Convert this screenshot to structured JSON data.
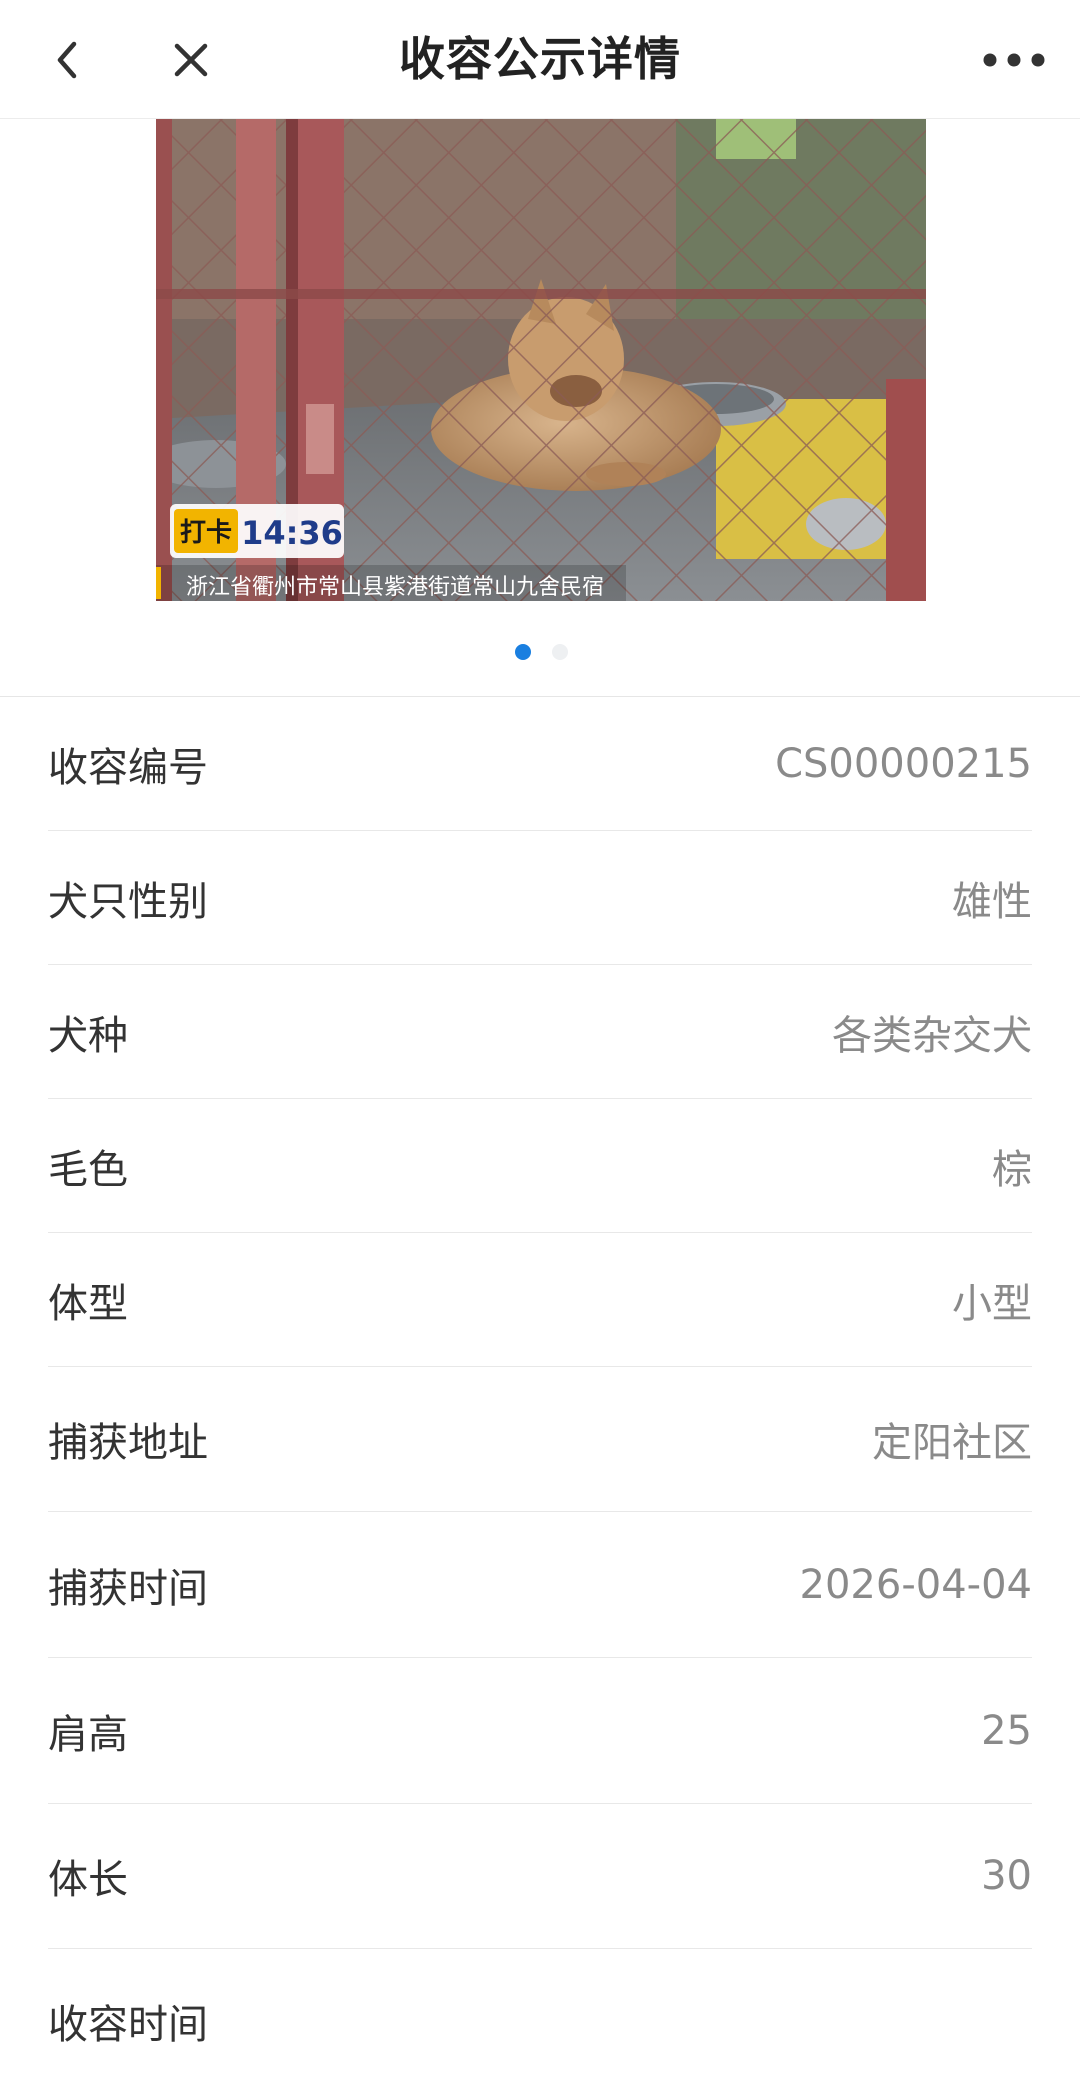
{
  "header": {
    "title": "收容公示详情",
    "back_icon": "chevron-left-icon",
    "close_icon": "close-icon",
    "more_icon": "more-horizontal-icon"
  },
  "carousel": {
    "photo": {
      "badge_label": "打卡",
      "badge_time": "14:36",
      "location_caption": "浙江省衢州市常山县紫港街道常山九舍民宿"
    },
    "slide_count": 2,
    "active_slide": 1,
    "accent_color": "#1a7fe0"
  },
  "details": [
    {
      "label": "收容编号",
      "value": "CS00000215"
    },
    {
      "label": "犬只性别",
      "value": "雄性"
    },
    {
      "label": "犬种",
      "value": "各类杂交犬"
    },
    {
      "label": "毛色",
      "value": "棕"
    },
    {
      "label": "体型",
      "value": "小型"
    },
    {
      "label": "捕获地址",
      "value": "定阳社区"
    },
    {
      "label": "捕获时间",
      "value": "2026-04-04"
    },
    {
      "label": "肩高",
      "value": "25"
    },
    {
      "label": "体长",
      "value": "30"
    },
    {
      "label": "收容时间",
      "value": ""
    }
  ]
}
